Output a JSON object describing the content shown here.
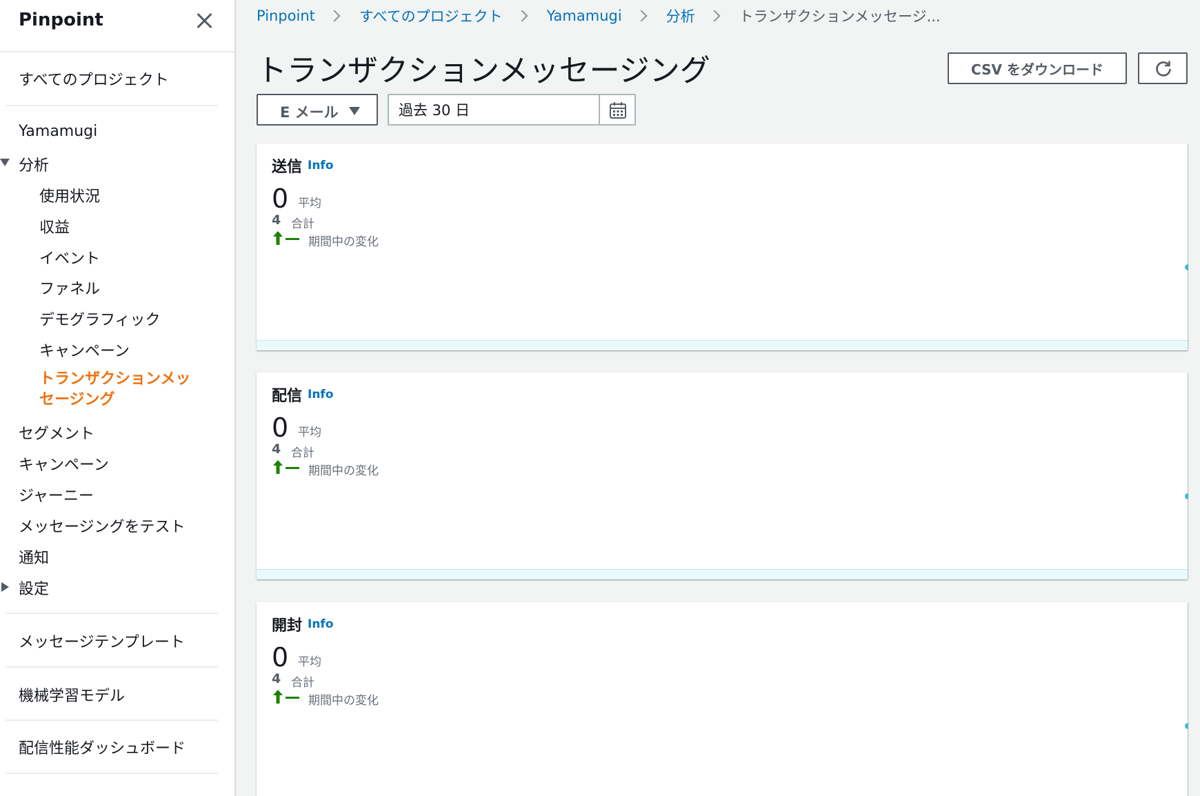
{
  "sidebar": {
    "title": "Pinpoint",
    "all_projects": "すべてのプロジェクト",
    "project_name": "Yamamugi",
    "analytics": "分析",
    "analytics_items": [
      "使用状況",
      "収益",
      "イベント",
      "ファネル",
      "デモグラフィック",
      "キャンペーン"
    ],
    "active_item": "トランザクションメッセージング",
    "items": [
      "セグメント",
      "キャンペーン",
      "ジャーニー",
      "メッセージングをテスト",
      "通知"
    ],
    "settings": "設定",
    "message_templates": "メッセージテンプレート",
    "ml_models": "機械学習モデル",
    "deliverability_dashboard": "配信性能ダッシュボード"
  },
  "breadcrumb": {
    "links": [
      "Pinpoint",
      "すべてのプロジェクト",
      "Yamamugi",
      "分析"
    ],
    "current": "トランザクションメッセージ..."
  },
  "header": {
    "title": "トランザクションメッセージング",
    "csv_button": "CSV をダウンロード"
  },
  "filters": {
    "channel": "E メール",
    "date_range": "過去 30 日"
  },
  "cards": [
    {
      "title": "送信",
      "info": "Info",
      "value": "0",
      "avg_label": "平均",
      "total": "4",
      "total_label": "合計",
      "change_label": "期間中の変化"
    },
    {
      "title": "配信",
      "info": "Info",
      "value": "0",
      "avg_label": "平均",
      "total": "4",
      "total_label": "合計",
      "change_label": "期間中の変化"
    },
    {
      "title": "開封",
      "info": "Info",
      "value": "0",
      "avg_label": "平均",
      "total": "4",
      "total_label": "合計",
      "change_label": "期間中の変化"
    }
  ],
  "colors": {
    "link": "#0073bb",
    "active_nav": "#ec7211",
    "trend_up": "#1d8102",
    "chart": "#44b9d6"
  }
}
